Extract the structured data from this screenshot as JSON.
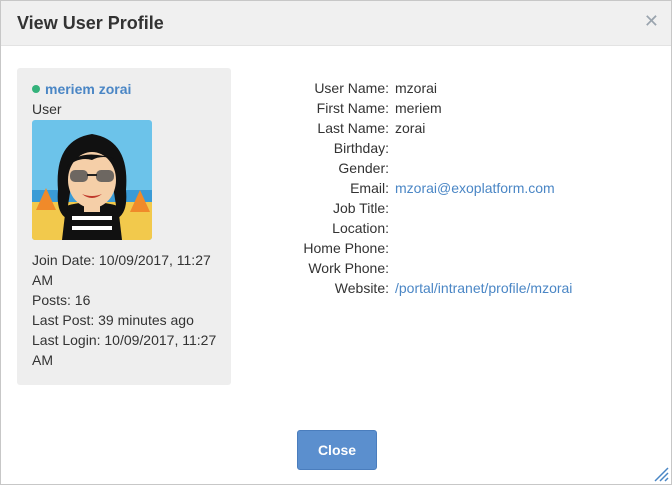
{
  "dialog": {
    "title": "View User Profile",
    "close_icon": "close-icon",
    "close_button": "Close"
  },
  "profile": {
    "status": "online",
    "status_color": "#34b27b",
    "name": "meriem zorai",
    "role": "User",
    "join_date": "Join Date: 10/09/2017, 11:27 AM",
    "posts": "Posts: 16",
    "last_post": "Last Post: 39 minutes ago",
    "last_login": "Last Login: 10/09/2017, 11:27 AM"
  },
  "details": [
    {
      "label": "User Name:",
      "value": "mzorai"
    },
    {
      "label": "First Name:",
      "value": "meriem"
    },
    {
      "label": "Last Name:",
      "value": "zorai"
    },
    {
      "label": "Birthday:",
      "value": ""
    },
    {
      "label": "Gender:",
      "value": ""
    },
    {
      "label": "Email:",
      "value": "mzorai@exoplatform.com"
    },
    {
      "label": "Job Title:",
      "value": ""
    },
    {
      "label": "Location:",
      "value": ""
    },
    {
      "label": "Home Phone:",
      "value": ""
    },
    {
      "label": "Work Phone:",
      "value": ""
    },
    {
      "label": "Website:",
      "value": "/portal/intranet/profile/mzorai"
    }
  ],
  "colors": {
    "link": "#4a86c5",
    "primary_button": "#5b8fce",
    "header_bg": "#f0f0f0",
    "panel_bg": "#eeeeee"
  }
}
